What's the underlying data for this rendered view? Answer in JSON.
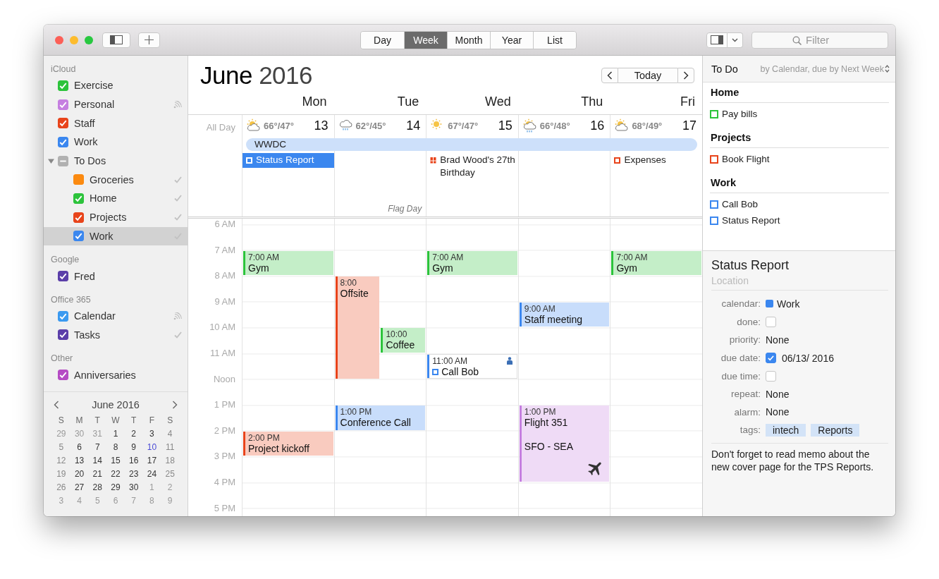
{
  "toolbar": {
    "views": [
      {
        "label": "Day",
        "selected": false
      },
      {
        "label": "Week",
        "selected": true
      },
      {
        "label": "Month",
        "selected": false
      },
      {
        "label": "Year",
        "selected": false
      },
      {
        "label": "List",
        "selected": false
      }
    ],
    "search": {
      "placeholder": "Filter"
    }
  },
  "sidebar": {
    "groups": [
      {
        "title": "iCloud",
        "items": [
          {
            "kind": "plain",
            "label": "Exercise",
            "color": "#2cc33b",
            "checked": true,
            "selected": false
          },
          {
            "kind": "shared",
            "label": "Personal",
            "color": "#c57fe0",
            "checked": true,
            "selected": false
          },
          {
            "kind": "plain",
            "label": "Staff",
            "color": "#e8441b",
            "checked": true,
            "selected": false
          },
          {
            "kind": "plain",
            "label": "Work",
            "color": "#3b87ef",
            "checked": true,
            "selected": false
          },
          {
            "kind": "plain",
            "label": "To Dos",
            "color": "#b1b1b1",
            "checked": false,
            "mixed": true,
            "selected": false,
            "expanded": true,
            "children": [
              {
                "kind": "synced",
                "label": "Groceries",
                "color": "#fb8a10",
                "checked": false,
                "selected": false
              },
              {
                "kind": "synced",
                "label": "Home",
                "color": "#2cc33b",
                "checked": true,
                "selected": false
              },
              {
                "kind": "synced",
                "label": "Projects",
                "color": "#e8441b",
                "checked": true,
                "selected": false
              },
              {
                "kind": "synced",
                "label": "Work",
                "color": "#3b87ef",
                "checked": true,
                "selected": true
              }
            ]
          }
        ]
      },
      {
        "title": "Google",
        "items": [
          {
            "kind": "plain",
            "label": "Fred",
            "color": "#5b3fa9",
            "checked": true,
            "selected": false
          }
        ]
      },
      {
        "title": "Office 365",
        "items": [
          {
            "kind": "shared",
            "label": "Calendar",
            "color": "#3b9af0",
            "checked": true,
            "selected": false
          },
          {
            "kind": "synced",
            "label": "Tasks",
            "color": "#5b3fa9",
            "checked": true,
            "selected": false
          }
        ]
      },
      {
        "title": "Other",
        "items": [
          {
            "kind": "plain",
            "label": "Anniversaries",
            "color": "#b54bc4",
            "checked": true,
            "selected": false
          }
        ]
      }
    ],
    "mini_calendar": {
      "title": "June 2016",
      "weekdays": [
        "S",
        "M",
        "T",
        "W",
        "T",
        "F",
        "S"
      ],
      "weeks": [
        [
          {
            "d": "29",
            "out": true
          },
          {
            "d": "30",
            "out": true
          },
          {
            "d": "31",
            "out": true
          },
          {
            "d": "1"
          },
          {
            "d": "2"
          },
          {
            "d": "3"
          },
          {
            "d": "4"
          }
        ],
        [
          {
            "d": "5"
          },
          {
            "d": "6"
          },
          {
            "d": "7"
          },
          {
            "d": "8"
          },
          {
            "d": "9"
          },
          {
            "d": "10",
            "today": true
          },
          {
            "d": "11"
          }
        ],
        [
          {
            "d": "12"
          },
          {
            "d": "13"
          },
          {
            "d": "14"
          },
          {
            "d": "15"
          },
          {
            "d": "16"
          },
          {
            "d": "17"
          },
          {
            "d": "18"
          }
        ],
        [
          {
            "d": "19"
          },
          {
            "d": "20"
          },
          {
            "d": "21"
          },
          {
            "d": "22"
          },
          {
            "d": "23"
          },
          {
            "d": "24"
          },
          {
            "d": "25"
          }
        ],
        [
          {
            "d": "26"
          },
          {
            "d": "27"
          },
          {
            "d": "28"
          },
          {
            "d": "29"
          },
          {
            "d": "30"
          },
          {
            "d": "1",
            "out": true
          },
          {
            "d": "2",
            "out": true
          }
        ],
        [
          {
            "d": "3",
            "out": true
          },
          {
            "d": "4",
            "out": true
          },
          {
            "d": "5",
            "out": true
          },
          {
            "d": "6",
            "out": true
          },
          {
            "d": "7",
            "out": true
          },
          {
            "d": "8",
            "out": true
          },
          {
            "d": "9",
            "out": true
          }
        ]
      ]
    }
  },
  "week": {
    "title": "**June** 2016",
    "today_button": "Today",
    "all_day_label": "All Day",
    "banner": {
      "title": "WWDC"
    },
    "hours": [
      "6 AM",
      "7 AM",
      "8 AM",
      "9 AM",
      "10 AM",
      "11 AM",
      "Noon",
      "1 PM",
      "2 PM",
      "3 PM",
      "4 PM",
      "5 PM"
    ],
    "days": [
      {
        "name": "Mon",
        "date": "13",
        "weather": {
          "kind": "partly-sunny",
          "temps": "66°/47°"
        },
        "all_day": [
          {
            "title": "Status Report",
            "kind": "task",
            "color": "#3b87ef",
            "selected": true
          }
        ],
        "events": [
          {
            "kind": "event",
            "time": "7:00 AM",
            "title": "Gym",
            "duration": {
              "kind": "one"
            },
            "color": "#2cc33b"
          },
          {
            "kind": "event",
            "time": "2:00 PM",
            "title": "Project kickoff",
            "duration": {
              "kind": "one"
            },
            "color": "#e8441b"
          }
        ]
      },
      {
        "name": "Tue",
        "date": "14",
        "weather": {
          "kind": "rain",
          "temps": "62°/45°"
        },
        "all_day": [
          {
            "title": "Flag Day",
            "kind": "holiday"
          }
        ],
        "events": [
          {
            "kind": "event",
            "time": "8:00",
            "title": "Offsite",
            "duration": {
              "kind": "four"
            },
            "color": "#e8441b"
          },
          {
            "kind": "event",
            "time": "10:00",
            "title": "Coffee",
            "duration": {
              "kind": "one"
            },
            "color": "#2cc33b"
          },
          {
            "kind": "event",
            "time": "1:00 PM",
            "title": "Conference Call",
            "duration": {
              "kind": "one"
            },
            "color": "#3b87ef"
          }
        ]
      },
      {
        "name": "Wed",
        "date": "15",
        "weather": {
          "kind": "sunny",
          "temps": "67°/47°"
        },
        "all_day": [
          {
            "title": "Brad Wood's 27th Birthday",
            "kind": "birthday",
            "color": "#e8441b"
          }
        ],
        "events": [
          {
            "kind": "event",
            "time": "7:00 AM",
            "title": "Gym",
            "duration": {
              "kind": "one"
            },
            "color": "#2cc33b"
          },
          {
            "kind": "todo",
            "time": "11:00 AM",
            "title": "Call Bob",
            "duration": {
              "kind": "one"
            },
            "color": "#3b87ef"
          }
        ]
      },
      {
        "name": "Thu",
        "date": "16",
        "weather": {
          "kind": "partly-rain",
          "temps": "66°/48°"
        },
        "events": [
          {
            "kind": "event",
            "time": "9:00 AM",
            "title": "Staff meeting",
            "duration": {
              "kind": "one"
            },
            "color": "#3b87ef"
          },
          {
            "kind": "flight",
            "time": "1:00 PM",
            "title": "Flight 351",
            "location": "SFO - SEA",
            "duration": {
              "kind": "three"
            },
            "color": "#c57fe0"
          }
        ]
      },
      {
        "name": "Fri",
        "date": "17",
        "weather": {
          "kind": "partly-sunny",
          "temps": "68°/49°"
        },
        "all_day": [
          {
            "title": "Expenses",
            "kind": "task",
            "color": "#e8441b",
            "selected": false
          }
        ],
        "events": [
          {
            "kind": "event",
            "time": "7:00 AM",
            "title": "Gym",
            "duration": {
              "kind": "one"
            },
            "color": "#2cc33b"
          }
        ]
      }
    ]
  },
  "todo": {
    "title": "To Do",
    "sort": "by Calendar, due by Next Week",
    "groups": [
      {
        "title": "Home",
        "items": [
          {
            "title": "Pay bills",
            "color": "#2cc33b"
          }
        ]
      },
      {
        "title": "Projects",
        "items": [
          {
            "title": "Book Flight",
            "color": "#e8441b"
          }
        ]
      },
      {
        "title": "Work",
        "items": [
          {
            "title": "Call Bob",
            "color": "#3b87ef"
          },
          {
            "title": "Status Report",
            "color": "#3b87ef"
          }
        ]
      }
    ]
  },
  "details": {
    "title": "Status Report",
    "location_placeholder": "Location",
    "fields": [
      {
        "label": "calendar:",
        "kind": "calendar",
        "value": "Work",
        "color": "#3b87ef"
      },
      {
        "label": "done:",
        "kind": "checkbox",
        "checked": false
      },
      {
        "label": "priority:",
        "kind": "text",
        "value": "None"
      },
      {
        "label": "due date:",
        "kind": "checkbox",
        "checked": true,
        "value": "06/13/ 2016"
      },
      {
        "label": "due time:",
        "kind": "checkbox",
        "checked": false
      },
      {
        "label": "repeat:",
        "kind": "text",
        "value": "None"
      },
      {
        "label": "alarm:",
        "kind": "text",
        "value": "None"
      },
      {
        "label": "tags:",
        "kind": "tags",
        "tags": [
          "intech",
          "Reports"
        ]
      }
    ],
    "note": "Don't forget to read memo about the new cover page for the TPS Reports."
  }
}
